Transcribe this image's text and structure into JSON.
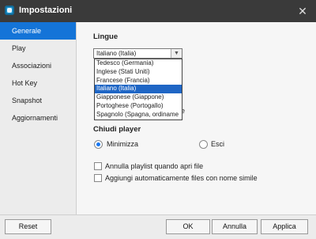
{
  "window": {
    "title": "Impostazioni"
  },
  "sidebar": {
    "items": [
      {
        "label": "Generale",
        "active": true
      },
      {
        "label": "Play"
      },
      {
        "label": "Associazioni"
      },
      {
        "label": "Hot Key"
      },
      {
        "label": "Snapshot"
      },
      {
        "label": "Aggiornamenti"
      }
    ]
  },
  "main": {
    "languages_label": "Lingue",
    "language_value": "Italiano (Italia)",
    "language_options": [
      "Tedesco (Germania)",
      "Inglese (Stati Uniti)",
      "Francese (Francia)",
      "Italiano (Italia)",
      "Giapponese (Giappone)",
      "Portoghese (Portogallo)",
      "Spagnolo (Spagna, ordiname"
    ],
    "covered_text_fragment": "e",
    "close_player_label": "Chiudi player",
    "radio_minimize": "Minimizza",
    "radio_exit": "Esci",
    "checkbox_playlist": "Annulla playlist quando apri file",
    "checkbox_autoadd": "Aggiungi automaticamente files con nome simile"
  },
  "footer": {
    "reset": "Reset",
    "ok": "OK",
    "cancel": "Annulla",
    "apply": "Applica"
  }
}
